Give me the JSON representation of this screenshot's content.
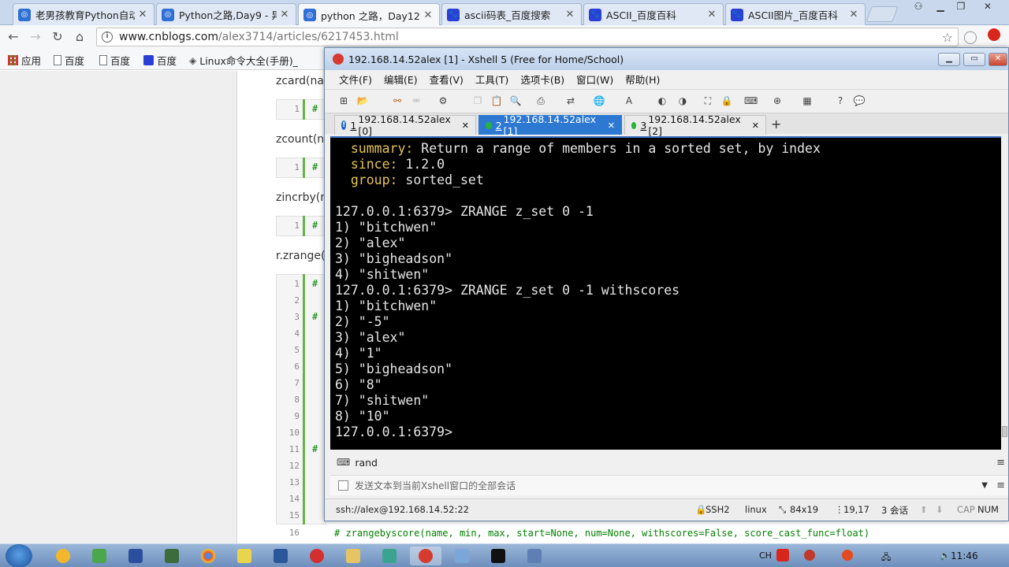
{
  "browser": {
    "tabs": [
      {
        "title": "老男孩教育Python自动",
        "icon": "cnblogs-icon"
      },
      {
        "title": "Python之路,Day9 - 异",
        "icon": "cnblogs-icon"
      },
      {
        "title": "python 之路，Day12",
        "icon": "cnblogs-icon"
      },
      {
        "title": "ascii码表_百度搜索",
        "icon": "baidu-paw-icon"
      },
      {
        "title": "ASCII_百度百科",
        "icon": "baidu-paw-icon"
      },
      {
        "title": "ASCII图片_百度百科",
        "icon": "baidu-paw-icon"
      }
    ],
    "url_host": "www.cnblogs.com",
    "url_path": "/alex3714/articles/6217453.html",
    "bookmarks": [
      "应用",
      "百度",
      "百度",
      "百度",
      "Linux命令大全(手册)_"
    ]
  },
  "page": {
    "sections": [
      "zcard(na",
      "zcount(n",
      "zincrby(n",
      "r.zrange("
    ],
    "line_numbers": [
      "1",
      "1",
      "1",
      "1",
      "2",
      "3",
      "4",
      "5",
      "6",
      "7",
      "8",
      "9",
      "10",
      "11",
      "12",
      "13",
      "14",
      "15",
      "16"
    ],
    "code_line_16": "# zrangebyscore(name, min, max, start=None, num=None, withscores=False, score_cast_func=float)"
  },
  "xshell": {
    "title": "192.168.14.52alex [1] - Xshell 5 (Free for Home/School)",
    "menu": [
      "文件(F)",
      "编辑(E)",
      "查看(V)",
      "工具(T)",
      "选项卡(B)",
      "窗口(W)",
      "帮助(H)"
    ],
    "session_tabs": [
      {
        "num": "1",
        "label": "192.168.14.52alex [0]"
      },
      {
        "num": "2",
        "label": "192.168.14.52alex [1]"
      },
      {
        "num": "3",
        "label": "192.168.14.52alex [2]"
      }
    ],
    "terminal": {
      "help_summary_key": "summary:",
      "help_summary_val": " Return a range of members in a sorted set, by index",
      "help_since_key": "since:",
      "help_since_val": " 1.2.0",
      "help_group_key": "group:",
      "help_group_val": " sorted_set",
      "lines": [
        "127.0.0.1:6379> ZRANGE z_set 0 -1",
        "1) \"bitchwen\"",
        "2) \"alex\"",
        "3) \"bigheadson\"",
        "4) \"shitwen\"",
        "127.0.0.1:6379> ZRANGE z_set 0 -1 withscores",
        "1) \"bitchwen\"",
        "2) \"-5\"",
        "3) \"alex\"",
        "4) \"1\"",
        "5) \"bigheadson\"",
        "6) \"8\"",
        "7) \"shitwen\"",
        "8) \"10\"",
        "127.0.0.1:6379> "
      ]
    },
    "quick_command": "rand",
    "compose_placeholder": "发送文本到当前Xshell窗口的全部会话",
    "status": {
      "connection": "ssh://alex@192.168.14.52:22",
      "protocol": "SSH2",
      "term_type": "linux",
      "size": "84x19",
      "cursor": "19,17",
      "sessions": "3 会话",
      "caps": "CAP",
      "num": "NUM"
    }
  },
  "taskbar": {
    "ime": "CH",
    "clock": "11:46"
  }
}
